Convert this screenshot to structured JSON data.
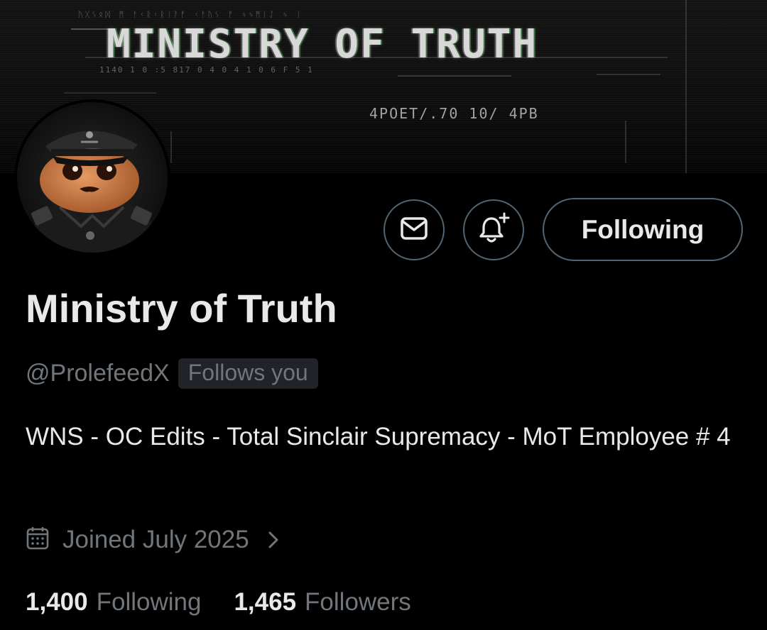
{
  "banner": {
    "title": "MINISTRY OF TRUTH",
    "code": "4POET/.70 10/ 4PB"
  },
  "profile": {
    "name": "Ministry of Truth",
    "handle": "@ProlefeedX",
    "follows_you_badge": "Follows you",
    "bio": "WNS - OC Edits - Total Sinclair Supremacy - MoT Employee # 4",
    "joined": "Joined July 2025"
  },
  "actions": {
    "message_icon": "envelope-icon",
    "notify_icon": "bell-plus-icon",
    "follow_label": "Following"
  },
  "stats": {
    "following_count": "1,400",
    "following_label": "Following",
    "followers_count": "1,465",
    "followers_label": "Followers"
  },
  "colors": {
    "background": "#000000",
    "text_primary": "#e7e9ea",
    "text_secondary": "#71767b",
    "border": "#536471",
    "badge_bg": "#202327"
  }
}
